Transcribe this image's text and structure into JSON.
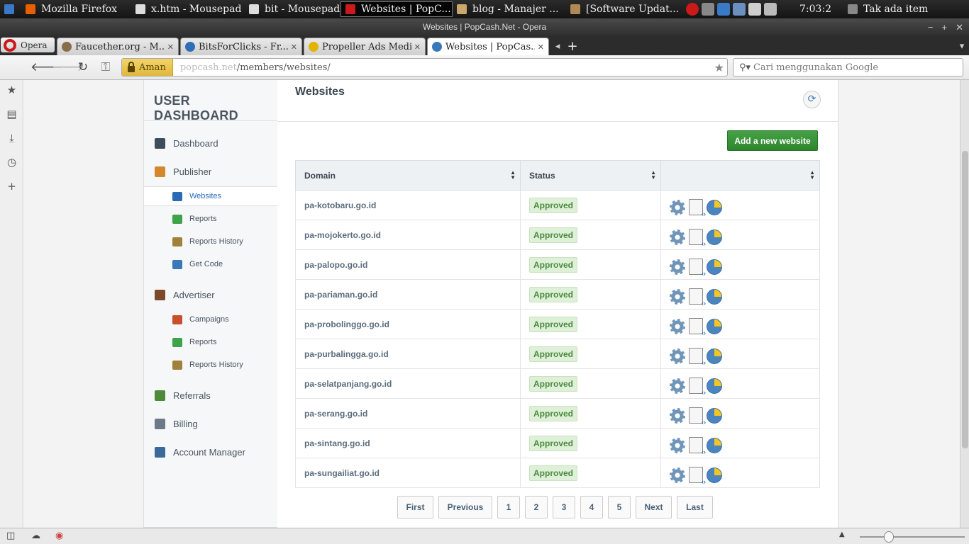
{
  "os_taskbar": {
    "items": [
      {
        "label": "Mozilla Firefox",
        "color": "#e66000"
      },
      {
        "label": "x.htm - Mousepad",
        "color": "#dddddd"
      },
      {
        "label": "bit - Mousepad",
        "color": "#dddddd"
      },
      {
        "label": "Websites | PopC...",
        "color": "#cc1a1a"
      },
      {
        "label": "blog - Manajer ...",
        "color": "#c9a86a"
      },
      {
        "label": "[Software Updat...",
        "color": "#b08a55"
      }
    ],
    "clock": "7:03:2",
    "status_text": "Tak ada item"
  },
  "window": {
    "title": "Websites | PopCash.Net - Opera"
  },
  "tabs": {
    "opera_label": "Opera",
    "items": [
      {
        "label": "Faucether.org - M...",
        "active": false,
        "color": "#8a6d4a"
      },
      {
        "label": "BitsForClicks - Fr...",
        "active": false,
        "color": "#2f6db5"
      },
      {
        "label": "Propeller Ads Media",
        "active": false,
        "color": "#e2b400"
      },
      {
        "label": "Websites | PopCas...",
        "active": true,
        "color": "#3a79b8"
      }
    ]
  },
  "address_bar": {
    "secure_label": "Aman",
    "url_host": "popcash.net",
    "url_path": "/members/websites/",
    "search_placeholder": "Cari menggunakan Google"
  },
  "dashboard": {
    "title": "USER DASHBOARD",
    "nav": [
      {
        "label": "Dashboard",
        "level": "main",
        "color": "#3d4d5c"
      },
      {
        "label": "Publisher",
        "level": "main",
        "color": "#d4882b"
      },
      {
        "label": "Websites",
        "level": "sub",
        "selected": true,
        "color": "#2a6bb5"
      },
      {
        "label": "Reports",
        "level": "sub",
        "color": "#3fa34a"
      },
      {
        "label": "Reports History",
        "level": "sub",
        "color": "#a0813b"
      },
      {
        "label": "Get Code",
        "level": "sub",
        "color": "#3a79b8"
      },
      {
        "label": "Advertiser",
        "level": "main",
        "color": "#7a4a2a"
      },
      {
        "label": "Campaigns",
        "level": "sub",
        "color": "#c8502a"
      },
      {
        "label": "Reports",
        "level": "sub",
        "color": "#3fa34a"
      },
      {
        "label": "Reports History",
        "level": "sub",
        "color": "#a0813b"
      },
      {
        "label": "Referrals",
        "level": "main",
        "color": "#4f8a3a"
      },
      {
        "label": "Billing",
        "level": "main",
        "color": "#6c7a88"
      },
      {
        "label": "Account Manager",
        "level": "main",
        "color": "#3a6a9a"
      }
    ]
  },
  "panel": {
    "title": "Websites",
    "add_button": "Add a new website",
    "columns": [
      "Domain",
      "Status",
      ""
    ],
    "rows": [
      {
        "domain": "pa-kotobaru.go.id",
        "status": "Approved"
      },
      {
        "domain": "pa-mojokerto.go.id",
        "status": "Approved"
      },
      {
        "domain": "pa-palopo.go.id",
        "status": "Approved"
      },
      {
        "domain": "pa-pariaman.go.id",
        "status": "Approved"
      },
      {
        "domain": "pa-probolinggo.go.id",
        "status": "Approved"
      },
      {
        "domain": "pa-purbalingga.go.id",
        "status": "Approved"
      },
      {
        "domain": "pa-selatpanjang.go.id",
        "status": "Approved"
      },
      {
        "domain": "pa-serang.go.id",
        "status": "Approved"
      },
      {
        "domain": "pa-sintang.go.id",
        "status": "Approved"
      },
      {
        "domain": "pa-sungailiat.go.id",
        "status": "Approved"
      }
    ],
    "pagination": [
      "First",
      "Previous",
      "1",
      "2",
      "3",
      "4",
      "5",
      "Next",
      "Last"
    ]
  }
}
